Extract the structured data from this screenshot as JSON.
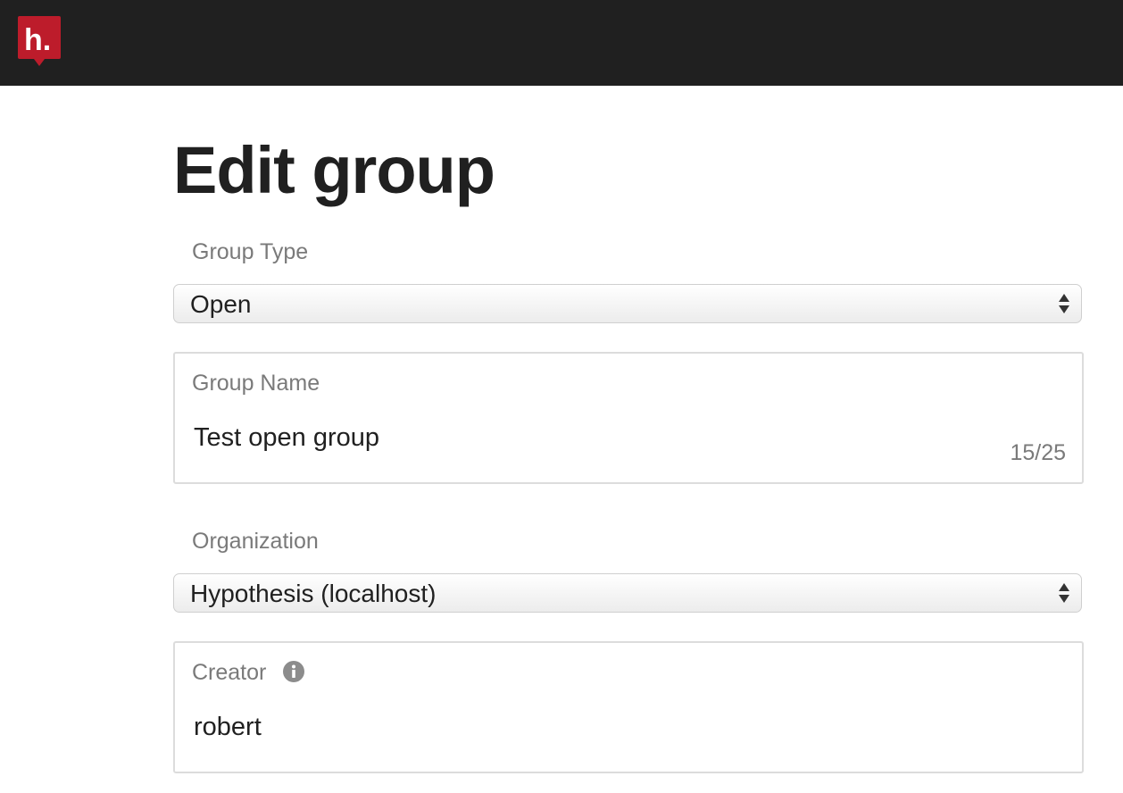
{
  "header": {
    "logo_text": "h."
  },
  "page": {
    "title": "Edit group"
  },
  "form": {
    "group_type": {
      "label": "Group Type",
      "value": "Open"
    },
    "group_name": {
      "label": "Group Name",
      "value": "Test open group",
      "counter": "15/25"
    },
    "organization": {
      "label": "Organization",
      "value": "Hypothesis (localhost)"
    },
    "creator": {
      "label": "Creator",
      "value": "robert",
      "icon": "info-icon"
    }
  },
  "colors": {
    "topbar": "#202020",
    "brand": "#bd1c2b",
    "label": "#7a7a7a",
    "text": "#202020"
  }
}
